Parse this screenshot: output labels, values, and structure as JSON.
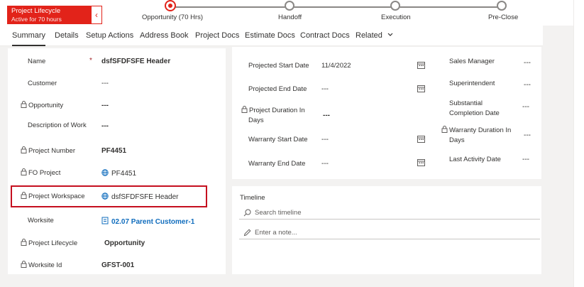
{
  "stage": {
    "title": "Project Lifecycle",
    "subtitle": "Active for 70 hours",
    "back_glyph": "‹"
  },
  "bpf": [
    {
      "label": "Opportunity  (70 Hrs)"
    },
    {
      "label": "Handoff"
    },
    {
      "label": "Execution"
    },
    {
      "label": "Pre-Close"
    }
  ],
  "tabs": [
    "Summary",
    "Details",
    "Setup Actions",
    "Address Book",
    "Project Docs",
    "Estimate Docs",
    "Contract Docs",
    "Related"
  ],
  "left_fields": [
    {
      "label": "Name",
      "value": "dsfSFDFSFE Header"
    },
    {
      "label": "Customer",
      "value": "---"
    },
    {
      "label": "Opportunity",
      "value": "---"
    },
    {
      "label": "Description of Work",
      "value": "---"
    },
    {
      "label": "Project Number",
      "value": "PF4451"
    },
    {
      "label": "FO Project",
      "value": "PF4451"
    },
    {
      "label": "Project Workspace",
      "value": "dsfSFDFSFE Header"
    },
    {
      "label": "Worksite",
      "value": "02.07 Parent Customer-1"
    },
    {
      "label": "Project Lifecycle",
      "value": "Opportunity"
    },
    {
      "label": "Worksite Id",
      "value": "GFST-001"
    }
  ],
  "mid_fields": [
    {
      "label": "Projected Start Date",
      "value": "11/4/2022"
    },
    {
      "label": "Projected End Date",
      "value": "---"
    },
    {
      "label_line1": "Project Duration In",
      "label_line2": "Days",
      "value": "---"
    },
    {
      "label": "Warranty Start Date",
      "value": "---"
    },
    {
      "label": "Warranty End Date",
      "value": "---"
    }
  ],
  "right_fields": [
    {
      "label": "Sales Manager",
      "value": "---"
    },
    {
      "label": "Superintendent",
      "value": "---"
    },
    {
      "label_line1": "Substantial",
      "label_line2": "Completion Date",
      "value": "---"
    },
    {
      "label_line1": "Warranty Duration In",
      "label_line2": "Days",
      "value": "---"
    },
    {
      "label": "Last Activity Date",
      "value": "---"
    }
  ],
  "timeline": {
    "title": "Timeline",
    "search_placeholder": "Search timeline",
    "note_placeholder": "Enter a note..."
  },
  "colors": {
    "accent_red": "#e2231a",
    "link_blue": "#0f6cbd"
  }
}
